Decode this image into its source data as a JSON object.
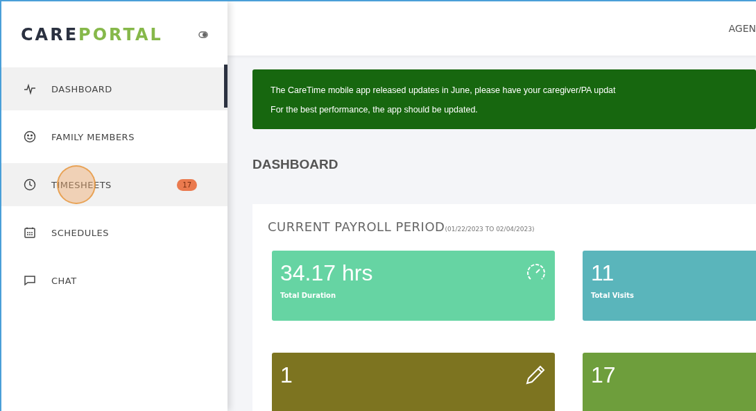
{
  "sidebar": {
    "logo": {
      "part_1": "CARE",
      "part_2": "PORTAL"
    },
    "items": [
      {
        "kind": "pulse",
        "label": "DASHBOARD",
        "selected": true,
        "hovered": false
      },
      {
        "kind": "smile",
        "label": "FAMILY MEMBERS",
        "selected": false,
        "hovered": false
      },
      {
        "kind": "clock",
        "label": "TIMESHEETS",
        "selected": false,
        "hovered": true,
        "badge": "17"
      },
      {
        "kind": "calendar",
        "label": "SCHEDULES",
        "selected": false,
        "hovered": false
      },
      {
        "kind": "chat",
        "label": "CHAT",
        "selected": false,
        "hovered": false
      }
    ]
  },
  "topbar": {
    "user_menu": "AGEN"
  },
  "banner": {
    "lines": [
      "The CareTime mobile app released updates in June, please have your caregiver/PA updat",
      "For the best performance, the app should be updated."
    ]
  },
  "page_title": "DASHBOARD",
  "payroll": {
    "title": "CURRENT PAYROLL PERIOD",
    "range": "(01/22/2023 TO 02/04/2023)",
    "cards": [
      {
        "value": "34.17 hrs",
        "label": "Total Duration",
        "color": "#66d4a3",
        "kind": "gauge"
      },
      {
        "value": "11",
        "label": "Total Visits",
        "color": "#5ab5bb",
        "kind": "plain"
      },
      {
        "value": "1",
        "color": "#7d7420",
        "kind": "pencil"
      },
      {
        "value": "17",
        "color": "#6e9e3c",
        "kind": "plain"
      }
    ]
  }
}
